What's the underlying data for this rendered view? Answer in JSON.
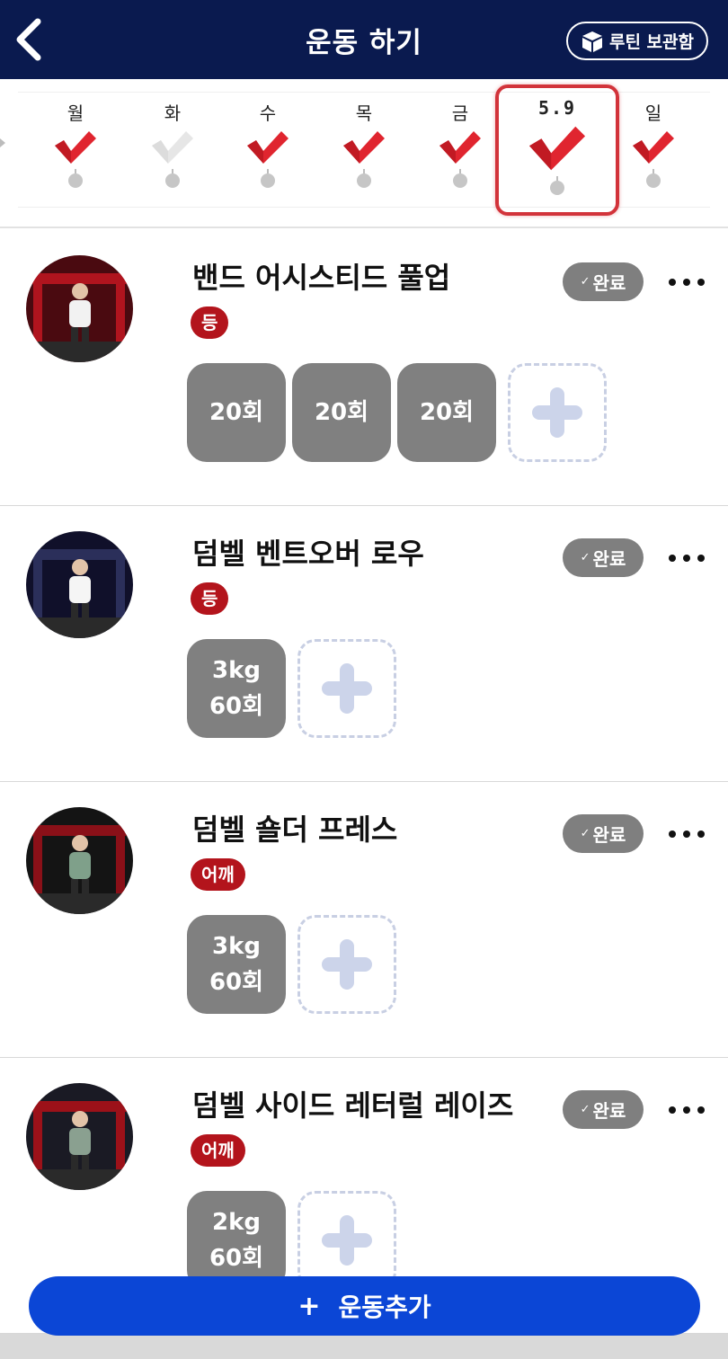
{
  "header": {
    "title": "운동 하기",
    "routine_button": "루틴 보관함",
    "back_icon": "chevron-left-icon",
    "routine_icon": "cube-icon"
  },
  "week": {
    "days": [
      {
        "label": "월",
        "checked": true
      },
      {
        "label": "화",
        "checked": false
      },
      {
        "label": "수",
        "checked": true
      },
      {
        "label": "목",
        "checked": true
      },
      {
        "label": "금",
        "checked": true
      },
      {
        "label": "5.9",
        "checked": true,
        "selected": true
      },
      {
        "label": "일",
        "checked": true
      }
    ],
    "check_color": "#e0252f",
    "unchecked_color": "#e6e6e6"
  },
  "exercises": [
    {
      "name": "밴드 어시스티드 풀업",
      "tag": "등",
      "done_label": "완료",
      "sets": [
        {
          "line1": "20회",
          "line2": ""
        },
        {
          "line1": "20회",
          "line2": ""
        },
        {
          "line1": "20회",
          "line2": ""
        }
      ]
    },
    {
      "name": "덤벨 벤트오버 로우",
      "tag": "등",
      "done_label": "완료",
      "sets": [
        {
          "line1": "3kg",
          "line2": "60회"
        }
      ]
    },
    {
      "name": "덤벨 숄더 프레스",
      "tag": "어깨",
      "done_label": "완료",
      "sets": [
        {
          "line1": "3kg",
          "line2": "60회"
        }
      ]
    },
    {
      "name": "덤벨 사이드 레터럴 레이즈",
      "tag": "어깨",
      "done_label": "완료",
      "sets": [
        {
          "line1": "2kg",
          "line2": "60회"
        }
      ]
    }
  ],
  "add_exercise": {
    "label": "운동추가",
    "plus": "+"
  },
  "colors": {
    "header_bg": "#0a1a4f",
    "accent_blue": "#0b46d6",
    "tag_red": "#b3141c",
    "set_gray": "#808080"
  }
}
